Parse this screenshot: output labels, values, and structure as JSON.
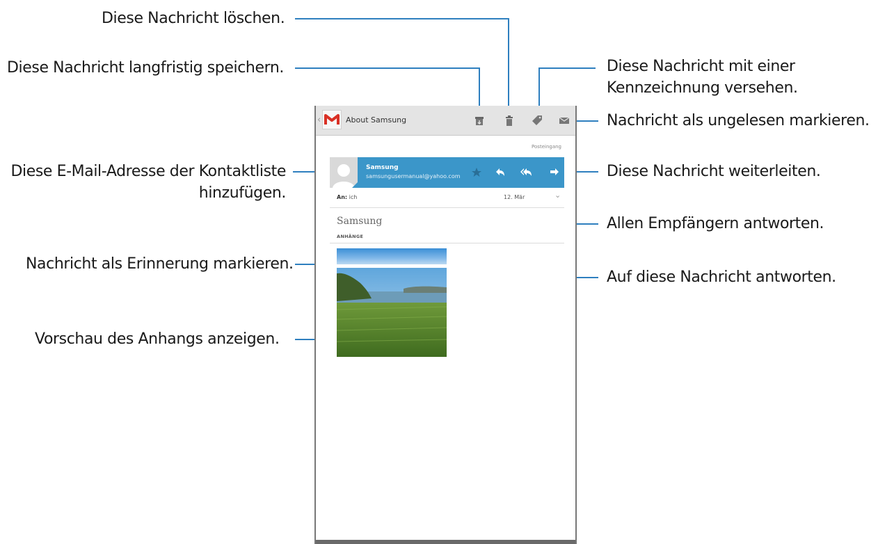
{
  "callouts": {
    "delete": "Diese Nachricht löschen.",
    "archive": "Diese Nachricht langfristig speichern.",
    "label_line1": "Diese Nachricht mit einer",
    "label_line2": "Kennzeichnung versehen.",
    "mark_unread": "Nachricht als ungelesen markieren.",
    "add_contact_line1": "Diese E-Mail-Adresse der Kontaktliste",
    "add_contact_line2": "hinzufügen.",
    "forward": "Diese Nachricht weiterleiten.",
    "reply_all": "Allen Empfängern antworten.",
    "star": "Nachricht als Erinnerung markieren.",
    "reply": "Auf diese Nachricht antworten.",
    "preview": "Vorschau des Anhangs anzeigen."
  },
  "app": {
    "title": "About Samsung",
    "folder": "Posteingang"
  },
  "message": {
    "sender_name": "Samsung",
    "sender_email": "samsungusermanual@yahoo.com",
    "to_label": "An:",
    "to_value": "ich",
    "date": "12. Mär",
    "subject": "Samsung",
    "attachments_label": "ANHÄNGE"
  },
  "icons": {
    "logo": "gmail-m-icon",
    "archive": "archive-icon",
    "delete": "trash-icon",
    "label": "tag-icon",
    "unread": "envelope-icon",
    "star": "star-icon",
    "reply": "reply-icon",
    "reply_all": "reply-all-icon",
    "forward": "forward-icon"
  },
  "colors": {
    "accent": "#3b96c9",
    "callout_line": "#2e7fbf",
    "gmail_red": "#d93025"
  }
}
